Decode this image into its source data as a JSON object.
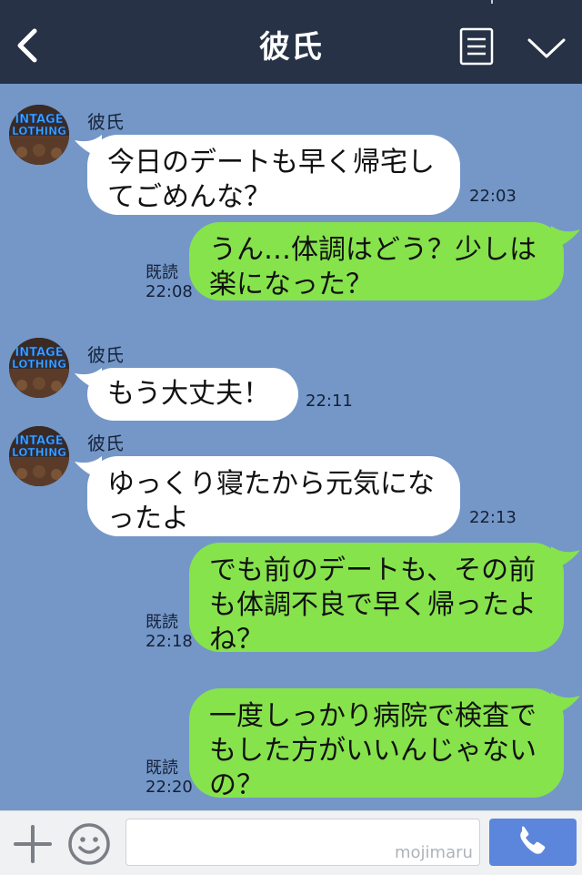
{
  "header": {
    "title": "彼氏",
    "back_icon": "chevron-left-icon",
    "menu_icon": "list-icon",
    "collapse_icon": "chevron-down-icon"
  },
  "messages": [
    {
      "sender": "彼氏",
      "text": "今日のデートも早く帰宅し\nてごめんな？",
      "time": "22:03",
      "direction": "in"
    },
    {
      "text": "うん…体調はどう？少しは\n楽になった？",
      "read": "既読",
      "time": "22:08",
      "direction": "out"
    },
    {
      "sender": "彼氏",
      "text": "もう大丈夫！",
      "time": "22:11",
      "direction": "in"
    },
    {
      "sender": "彼氏",
      "text": "ゆっくり寝たから元気にな\nったよ",
      "time": "22:13",
      "direction": "in"
    },
    {
      "text": "でも前のデートも、その前\nも体調不良で早く帰ったよ\nね？",
      "read": "既読",
      "time": "22:18",
      "direction": "out"
    },
    {
      "text": "一度しっかり病院で検査で\nもした方がいいんじゃない\nの？",
      "read": "既読",
      "time": "22:20",
      "direction": "out"
    }
  ],
  "avatar": {
    "line1": "INTAGE",
    "line2": "LOTHING"
  },
  "footer": {
    "plus_icon": "plus-icon",
    "emoji_icon": "smiley-icon",
    "input_value": "",
    "watermark": "mojimaru",
    "call_icon": "phone-icon"
  },
  "colors": {
    "chat_background": "#7497c7",
    "header": "#273246",
    "incoming_bubble": "#ffffff",
    "outgoing_bubble": "#86e34c",
    "call_button": "#5b86dc"
  }
}
